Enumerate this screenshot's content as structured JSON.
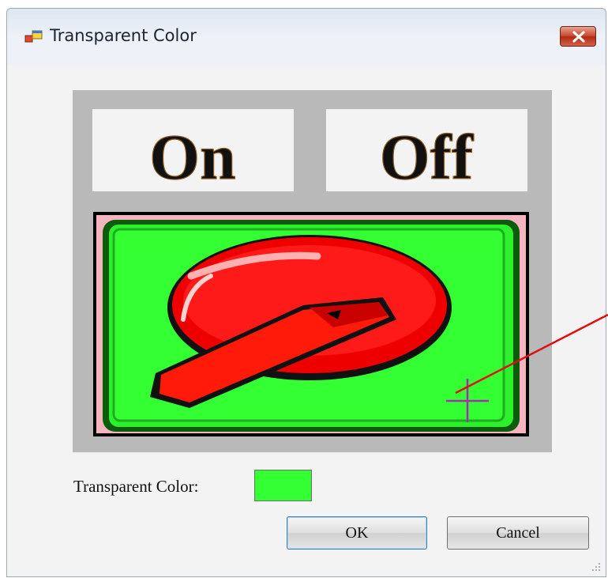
{
  "window": {
    "title": "Transparent Color",
    "icon": "app-window-icon",
    "close_icon": "close-icon"
  },
  "preview": {
    "on_label": "On",
    "off_label": "Off",
    "switch_color": "#ff0000",
    "background_color": "#33ff33",
    "cursor_icon": "crosshair-icon"
  },
  "transparent_color": {
    "label": "Transparent Color:",
    "swatch_color": "#33ff33"
  },
  "buttons": {
    "ok_label": "OK",
    "cancel_label": "Cancel"
  }
}
